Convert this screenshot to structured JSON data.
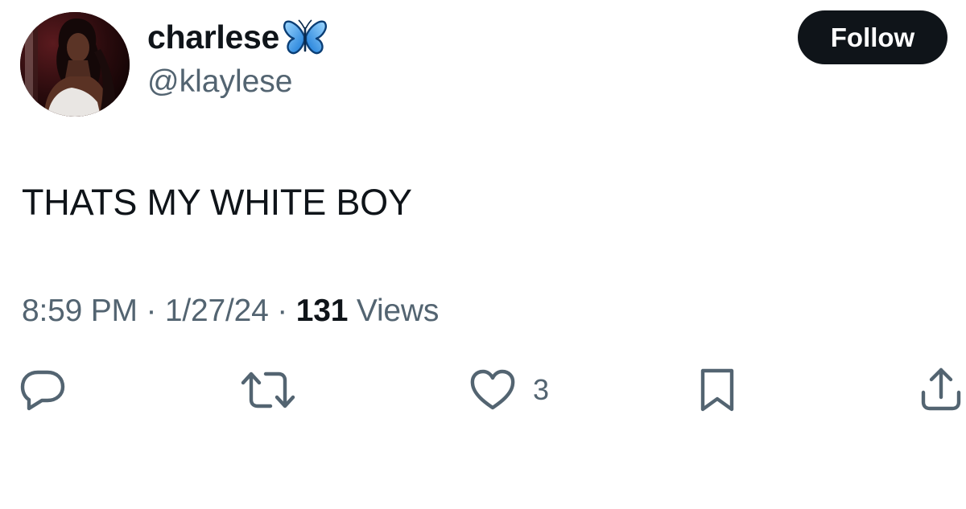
{
  "author": {
    "display_name": "charlese",
    "handle": "@klaylese",
    "name_emoji": "butterfly-icon"
  },
  "follow_button": {
    "label": "Follow"
  },
  "tweet": {
    "text": "THATS MY WHITE BOY",
    "time": "8:59 PM",
    "separator": "·",
    "date": "1/27/24",
    "views_count": "131",
    "views_label": "Views"
  },
  "actions": {
    "reply": {
      "icon": "reply-icon",
      "count": ""
    },
    "retweet": {
      "icon": "retweet-icon",
      "count": ""
    },
    "like": {
      "icon": "heart-icon",
      "count": "3"
    },
    "bookmark": {
      "icon": "bookmark-icon"
    },
    "share": {
      "icon": "share-icon"
    }
  },
  "colors": {
    "text_primary": "#0f1419",
    "text_secondary": "#536471",
    "follow_bg": "#0f1419",
    "follow_text": "#ffffff",
    "butterfly": "#1d9bf0"
  }
}
